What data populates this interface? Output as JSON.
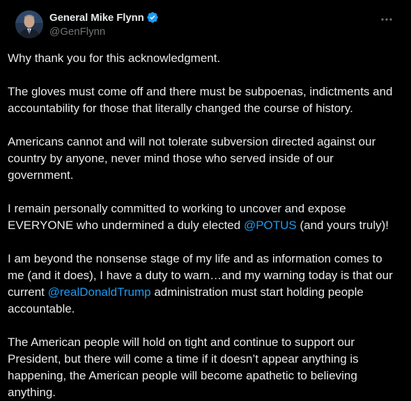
{
  "author": {
    "display_name": "General Mike Flynn",
    "handle": "@GenFlynn",
    "verified_icon": "verified-badge-icon",
    "verified_color": "#1d9bf0"
  },
  "menu": {
    "icon": "more-horizontal-icon"
  },
  "tweet": {
    "p1": "Why thank you for this acknowledgment.",
    "p2": "The gloves must come off and there must be subpoenas, indictments and accountability for those that literally changed the course of history.",
    "p3": "Americans cannot and will not tolerate subversion directed against our country by anyone, never mind those who served inside of our government.",
    "p4_before": "I remain personally committed to working to uncover and expose EVERYONE who undermined a duly elected ",
    "p4_mention": "@POTUS",
    "p4_after": " (and yours truly)!",
    "p5_before": "I am beyond the nonsense stage of my life and as information comes to me (and it does), I have a duty to warn…and my warning today is that our current ",
    "p5_mention": "@realDonaldTrump",
    "p5_after": " administration must start holding people accountable.",
    "p6": "The American people will hold on tight and continue to support our President, but there will come a time if it doesn’t appear anything is happening, the American people will become apathetic to believing anything."
  },
  "colors": {
    "background": "#000000",
    "text": "#e7e9ea",
    "secondary_text": "#71767b",
    "link": "#1d9bf0"
  }
}
